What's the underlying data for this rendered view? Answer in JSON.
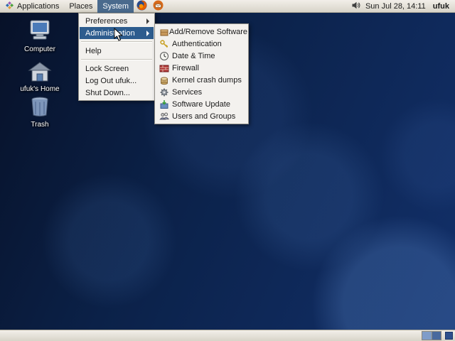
{
  "colors": {
    "panel_bg": "#d8d4c9",
    "menu_highlight": "#2d5c8e",
    "desktop_base": "#0b2148",
    "active_menu_bg": "#4a6a8d"
  },
  "top_panel": {
    "applications_label": "Applications",
    "places_label": "Places",
    "system_label": "System",
    "clock": "Sun Jul 28, 14:11",
    "user_label": "ufuk",
    "icons": [
      "distro-logo-icon",
      "firefox-icon",
      "email-launcher-icon",
      "volume-icon"
    ]
  },
  "desktop_icons": [
    {
      "label": "Computer",
      "icon": "computer-icon"
    },
    {
      "label": "ufuk's Home",
      "icon": "home-icon"
    },
    {
      "label": "Trash",
      "icon": "trash-icon"
    }
  ],
  "system_menu": {
    "items": [
      {
        "label": "Preferences",
        "has_submenu": true
      },
      {
        "label": "Administration",
        "has_submenu": true,
        "selected": true
      },
      {
        "label": "Help"
      },
      {
        "label": "Lock Screen"
      },
      {
        "label": "Log Out ufuk..."
      },
      {
        "label": "Shut Down..."
      }
    ]
  },
  "admin_submenu": {
    "items": [
      {
        "label": "Add/Remove Software",
        "icon": "package-icon"
      },
      {
        "label": "Authentication",
        "icon": "keys-icon"
      },
      {
        "label": "Date & Time",
        "icon": "clock-icon"
      },
      {
        "label": "Firewall",
        "icon": "firewall-icon"
      },
      {
        "label": "Kernel crash dumps",
        "icon": "crash-dump-icon"
      },
      {
        "label": "Services",
        "icon": "services-gear-icon"
      },
      {
        "label": "Software Update",
        "icon": "software-update-icon"
      },
      {
        "label": "Users and Groups",
        "icon": "users-groups-icon"
      }
    ]
  },
  "bottom_panel": {
    "workspace_count": 2
  }
}
